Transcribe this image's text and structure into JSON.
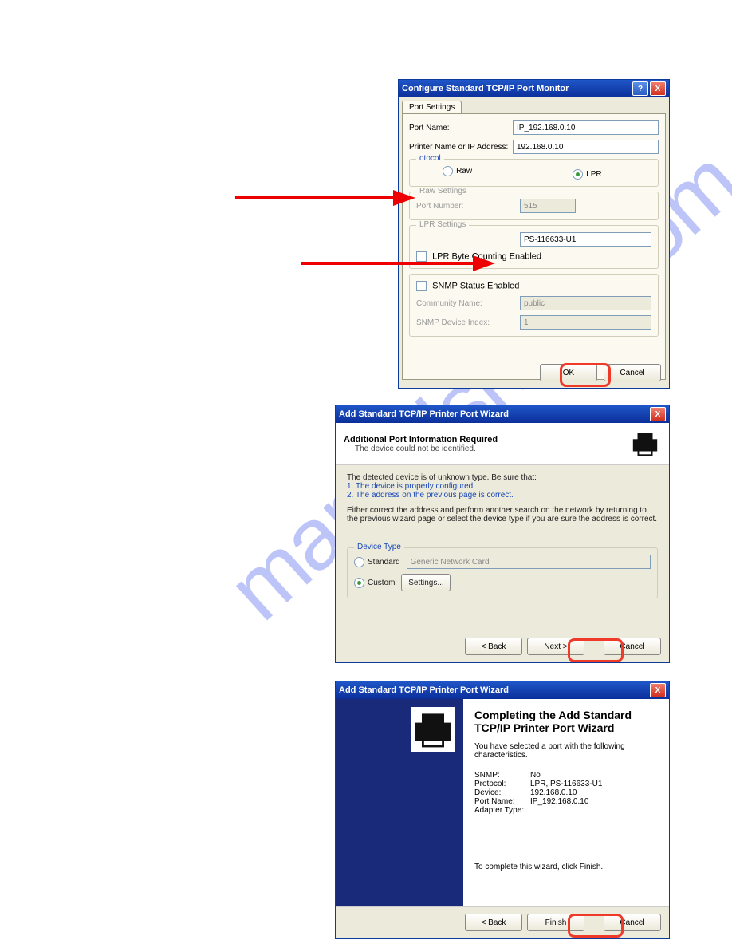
{
  "watermark": "manualshive.com",
  "dialog1": {
    "title": "Configure Standard TCP/IP Port Monitor",
    "tab": "Port Settings",
    "port_name_label": "Port Name:",
    "port_name_value": "IP_192.168.0.10",
    "printer_label": "Printer Name or IP Address:",
    "printer_value": "192.168.0.10",
    "protocol_title": "otocol",
    "raw_label": "Raw",
    "lpr_label": "LPR",
    "raw_settings_title": "Raw Settings",
    "port_number_label": "Port Number:",
    "port_number_value": "515",
    "lpr_settings_title": "LPR Settings",
    "queue_value": "PS-116633-U1",
    "lpr_byte_label": "LPR Byte Counting Enabled",
    "snmp_label": "SNMP Status Enabled",
    "community_label": "Community Name:",
    "community_value": "public",
    "snmp_index_label": "SNMP Device Index:",
    "snmp_index_value": "1",
    "ok": "OK",
    "cancel": "Cancel",
    "help_btn": "?",
    "close_btn": "X"
  },
  "dialog2": {
    "title": "Add Standard TCP/IP Printer Port Wizard",
    "close_btn": "X",
    "hdr1": "Additional Port Information Required",
    "hdr2": "The device could not be identified.",
    "intro": "The detected device is of unknown type.  Be sure that:",
    "li1": "1. The device is properly configured.",
    "li2": "2. The address on the previous page is correct.",
    "para2": "Either correct the address and perform another search on the network by returning to the previous wizard page or select the device type if you are sure the address is correct.",
    "devtype_title": "Device Type",
    "standard_label": "Standard",
    "standard_value": "Generic Network Card",
    "custom_label": "Custom",
    "settings_btn": "Settings...",
    "back": "< Back",
    "next": "Next >",
    "cancel": "Cancel"
  },
  "dialog3": {
    "title": "Add Standard TCP/IP Printer Port Wizard",
    "close_btn": "X",
    "big": "Completing the Add Standard TCP/IP Printer Port Wizard",
    "intro": "You have selected a port with the following characteristics.",
    "snmp_k": "SNMP:",
    "snmp_v": "No",
    "proto_k": "Protocol:",
    "proto_v": "LPR, PS-116633-U1",
    "dev_k": "Device:",
    "dev_v": "192.168.0.10",
    "port_k": "Port Name:",
    "port_v": "IP_192.168.0.10",
    "adapter_k": "Adapter Type:",
    "complete": "To complete this wizard, click Finish.",
    "back": "< Back",
    "finish": "Finish",
    "cancel": "Cancel"
  }
}
